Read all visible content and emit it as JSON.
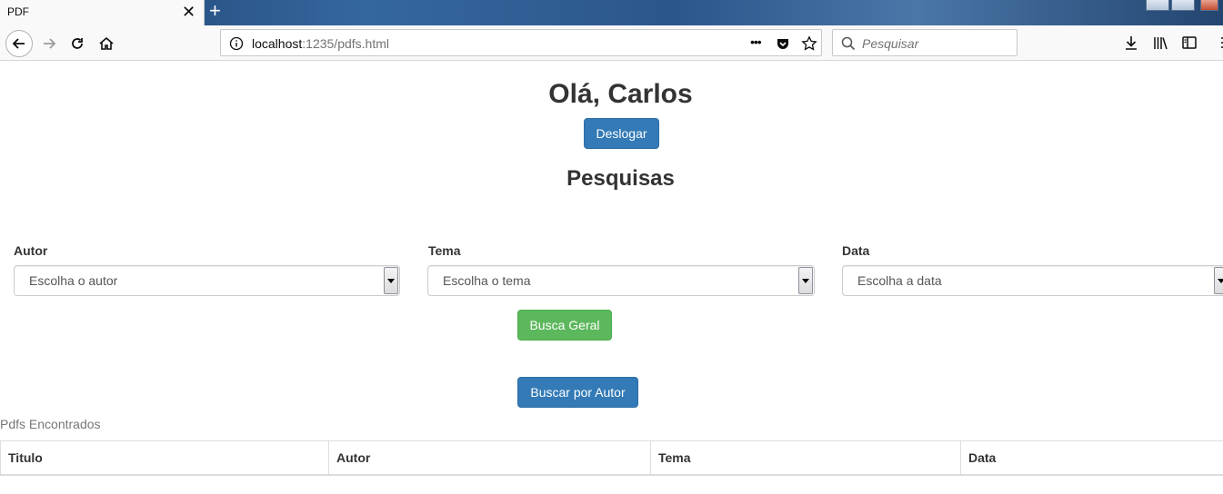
{
  "browser": {
    "tab_title": "PDF",
    "tab_close": "✕",
    "new_tab": "+",
    "url_host": "localhost",
    "url_path": ":1235/pdfs.html",
    "url_more": "•••",
    "search_placeholder": "Pesquisar"
  },
  "header": {
    "greeting": "Olá, Carlos",
    "logout_label": "Deslogar",
    "section_title": "Pesquisas"
  },
  "filters": [
    {
      "label": "Autor",
      "selected": "Escolha o autor"
    },
    {
      "label": "Tema",
      "selected": "Escolha o tema"
    },
    {
      "label": "Data",
      "selected": "Escolha a data"
    }
  ],
  "actions": {
    "general_search": "Busca Geral",
    "author_search": "Buscar por Autor"
  },
  "results": {
    "caption": "Pdfs Encontrados",
    "columns": [
      "Titulo",
      "Autor",
      "Tema",
      "Data"
    ]
  },
  "colors": {
    "primary": "#337ab7",
    "success": "#5cb85c"
  }
}
